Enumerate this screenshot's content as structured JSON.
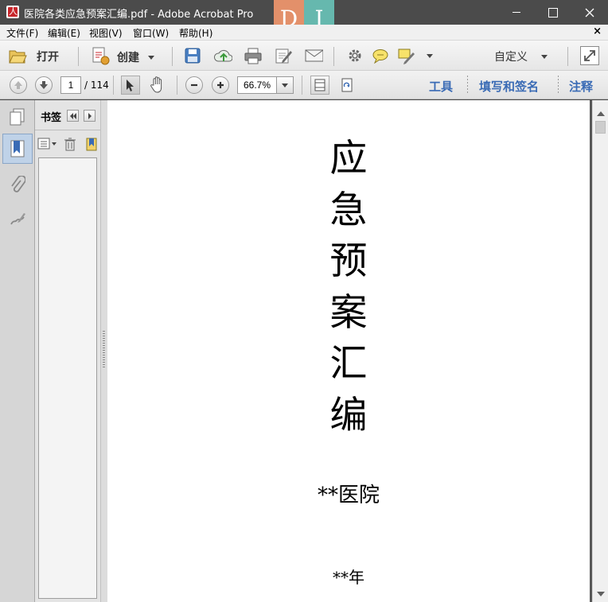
{
  "window": {
    "title": "医院各类应急预案汇编.pdf - Adobe Acrobat Pro",
    "logo_letters": [
      "D",
      "I"
    ]
  },
  "menubar": {
    "items": [
      "文件(F)",
      "编辑(E)",
      "视图(V)",
      "窗口(W)",
      "帮助(H)"
    ],
    "close_glyph": "×"
  },
  "toolbar1": {
    "open_label": "打开",
    "create_label": "创建",
    "customize_label": "自定义",
    "icons": [
      "folder-open-icon",
      "create-pdf-icon",
      "save-icon",
      "upload-icon",
      "print-icon",
      "edit-icon",
      "email-icon",
      "gear-icon",
      "comment-icon",
      "highlight-icon",
      "expand-icon"
    ]
  },
  "toolbar2": {
    "current_page": "1",
    "total_pages": "/ 114",
    "zoom": "66.7%",
    "tabs": [
      "工具",
      "填写和签名",
      "注释"
    ]
  },
  "bookmarks": {
    "title": "书签"
  },
  "document": {
    "title_chars": [
      "应",
      "急",
      "预",
      "案",
      "汇",
      "编"
    ],
    "hospital_line": "**医院",
    "year_line": "**年"
  }
}
